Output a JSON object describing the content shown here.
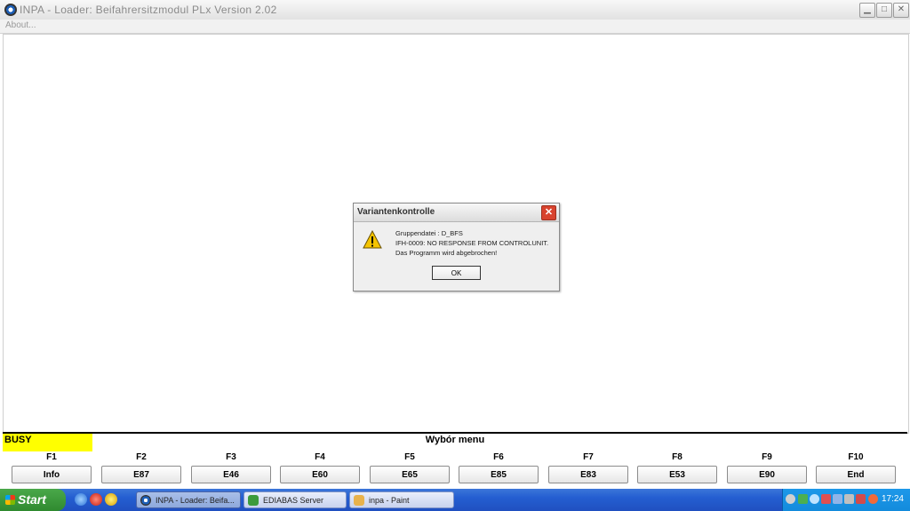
{
  "window": {
    "title": "INPA - Loader:  Beifahrersitzmodul PLx Version 2.02",
    "menu_about": "About..."
  },
  "status": {
    "busy": "BUSY",
    "menu_title": "Wybór menu"
  },
  "fkeys": [
    {
      "key": "F1",
      "label": "Info"
    },
    {
      "key": "F2",
      "label": "E87"
    },
    {
      "key": "F3",
      "label": "E46"
    },
    {
      "key": "F4",
      "label": "E60"
    },
    {
      "key": "F5",
      "label": "E65"
    },
    {
      "key": "F6",
      "label": "E85"
    },
    {
      "key": "F7",
      "label": "E83"
    },
    {
      "key": "F8",
      "label": "E53"
    },
    {
      "key": "F9",
      "label": "E90"
    },
    {
      "key": "F10",
      "label": "End"
    }
  ],
  "dialog": {
    "title": "Variantenkontrolle",
    "lines": [
      "Gruppendatei : D_BFS",
      "IFH-0009: NO RESPONSE FROM CONTROLUNIT.",
      "Das Programm wird abgebrochen!"
    ],
    "ok_label": "OK",
    "icon": "warning-icon"
  },
  "taskbar": {
    "start_label": "Start",
    "buttons": [
      {
        "label": "INPA - Loader:  Beifa...",
        "active": true
      },
      {
        "label": "EDIABAS Server",
        "active": false
      },
      {
        "label": "inpa - Paint",
        "active": false
      }
    ],
    "clock": "17:24"
  },
  "colors": {
    "busy_bg": "#ffff00",
    "taskbar_blue": "#245ed1",
    "start_green": "#3a9a3a",
    "close_red": "#d8432e"
  }
}
